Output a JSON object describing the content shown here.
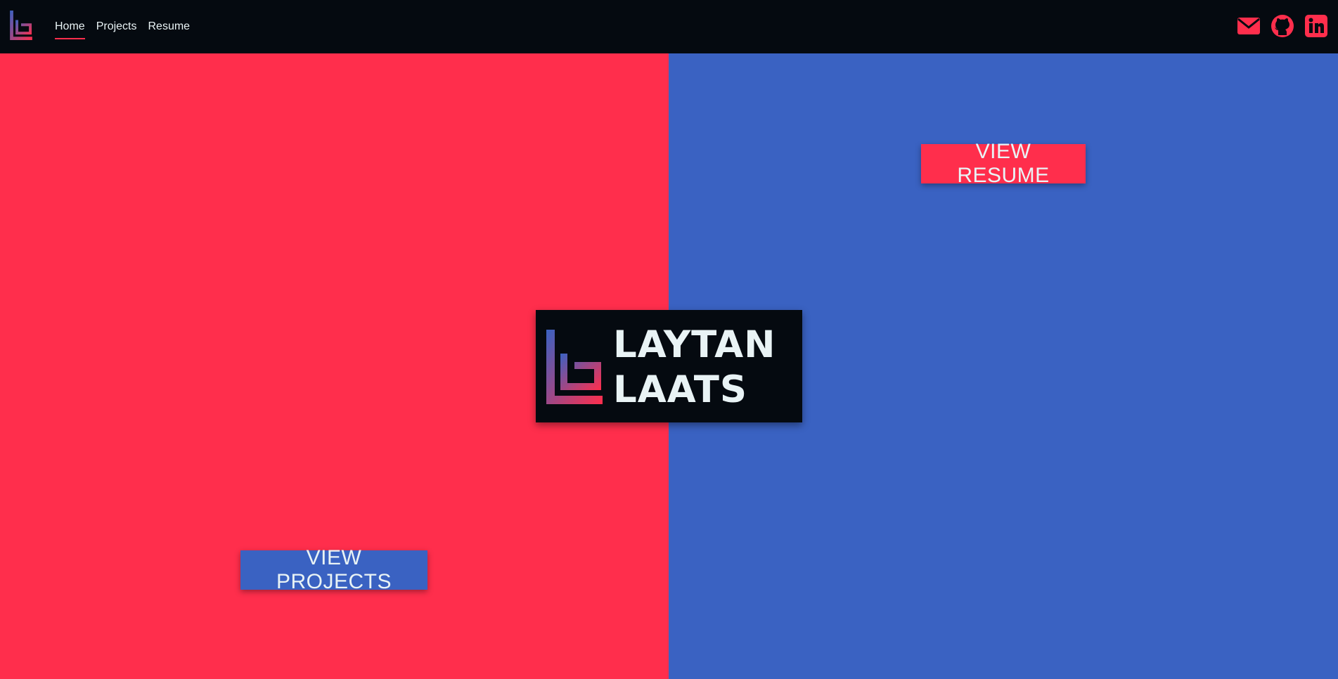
{
  "nav": {
    "links": [
      {
        "label": "Home",
        "active": true
      },
      {
        "label": "Projects",
        "active": false
      },
      {
        "label": "Resume",
        "active": false
      }
    ],
    "social_icons": [
      "envelope-icon",
      "github-icon",
      "linkedin-icon"
    ]
  },
  "hero": {
    "resume_button": "VIEW RESUME",
    "projects_button": "VIEW PROJECTS",
    "brand": {
      "first_name": "LAYTAN",
      "last_name": "LAATS"
    }
  },
  "colors": {
    "accent_red": "#ff2e4c",
    "accent_blue": "#3a62c2",
    "dark": "#050a10",
    "text_light": "#e9f3f5"
  }
}
